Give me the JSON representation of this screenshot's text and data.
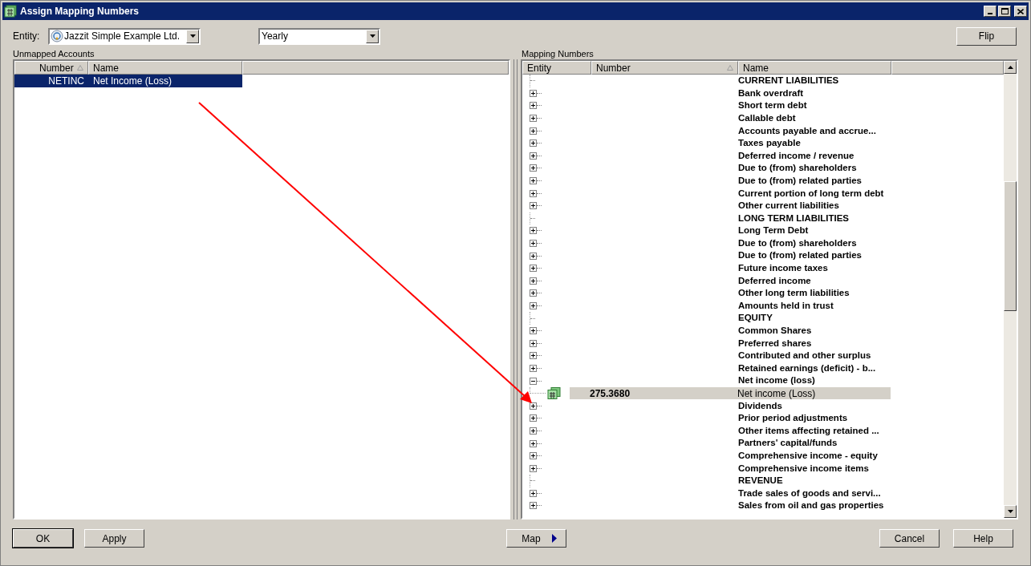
{
  "window": {
    "title": "Assign Mapping Numbers"
  },
  "entity": {
    "label": "Entity:",
    "value": "Jazzit Simple Example Ltd."
  },
  "period": {
    "value": "Yearly"
  },
  "flip_button": "Flip",
  "unmapped": {
    "title": "Unmapped Accounts",
    "columns": [
      "Number",
      "Name"
    ],
    "rows": [
      {
        "number": "NETINC",
        "name": "Net Income (Loss)",
        "selected": true
      }
    ]
  },
  "mapping": {
    "title": "Mapping Numbers",
    "columns": [
      "Entity",
      "Number",
      "Name"
    ],
    "rows": [
      {
        "kind": "header",
        "name": "CURRENT LIABILITIES"
      },
      {
        "kind": "group",
        "name": "Bank overdraft",
        "expanded": false
      },
      {
        "kind": "group",
        "name": "Short term debt",
        "expanded": false
      },
      {
        "kind": "group",
        "name": "Callable debt",
        "expanded": false
      },
      {
        "kind": "group",
        "name": "Accounts payable and accrue...",
        "expanded": false
      },
      {
        "kind": "group",
        "name": "Taxes payable",
        "expanded": false
      },
      {
        "kind": "group",
        "name": "Deferred income / revenue",
        "expanded": false
      },
      {
        "kind": "group",
        "name": "Due to (from) shareholders",
        "expanded": false
      },
      {
        "kind": "group",
        "name": "Due to (from) related parties",
        "expanded": false
      },
      {
        "kind": "group",
        "name": "Current portion of long term debt",
        "expanded": false
      },
      {
        "kind": "group",
        "name": "Other current liabilities",
        "expanded": false
      },
      {
        "kind": "header",
        "name": "LONG TERM LIABILITIES"
      },
      {
        "kind": "group",
        "name": "Long Term Debt",
        "expanded": false
      },
      {
        "kind": "group",
        "name": "Due to (from) shareholders",
        "expanded": false
      },
      {
        "kind": "group",
        "name": "Due to (from) related parties",
        "expanded": false
      },
      {
        "kind": "group",
        "name": "Future income taxes",
        "expanded": false
      },
      {
        "kind": "group",
        "name": "Deferred income",
        "expanded": false
      },
      {
        "kind": "group",
        "name": "Other long term liabilities",
        "expanded": false
      },
      {
        "kind": "group",
        "name": "Amounts held in trust",
        "expanded": false
      },
      {
        "kind": "header",
        "name": "EQUITY"
      },
      {
        "kind": "group",
        "name": "Common Shares",
        "expanded": false
      },
      {
        "kind": "group",
        "name": "Preferred shares",
        "expanded": false
      },
      {
        "kind": "group",
        "name": "Contributed and other surplus",
        "expanded": false
      },
      {
        "kind": "group",
        "name": "Retained earnings (deficit) - b...",
        "expanded": false
      },
      {
        "kind": "group",
        "name": "Net income (loss)",
        "expanded": true,
        "children": [
          {
            "number": "275.3680",
            "name": "Net income (Loss)",
            "selected": true
          }
        ]
      },
      {
        "kind": "group",
        "name": "Dividends",
        "expanded": false
      },
      {
        "kind": "group",
        "name": "Prior period adjustments",
        "expanded": false
      },
      {
        "kind": "group",
        "name": "Other items affecting retained ...",
        "expanded": false
      },
      {
        "kind": "group",
        "name": "Partners' capital/funds",
        "expanded": false
      },
      {
        "kind": "group",
        "name": "Comprehensive income - equity",
        "expanded": false
      },
      {
        "kind": "group",
        "name": "Comprehensive income items",
        "expanded": false
      },
      {
        "kind": "header",
        "name": "REVENUE"
      },
      {
        "kind": "group",
        "name": "Trade sales of goods and servi...",
        "expanded": false
      },
      {
        "kind": "group",
        "name": "Sales from oil and gas properties",
        "expanded": false
      }
    ]
  },
  "buttons_left": [
    "OK",
    "Apply"
  ],
  "map_button": "Map",
  "buttons_right": [
    "Cancel",
    "Help"
  ]
}
